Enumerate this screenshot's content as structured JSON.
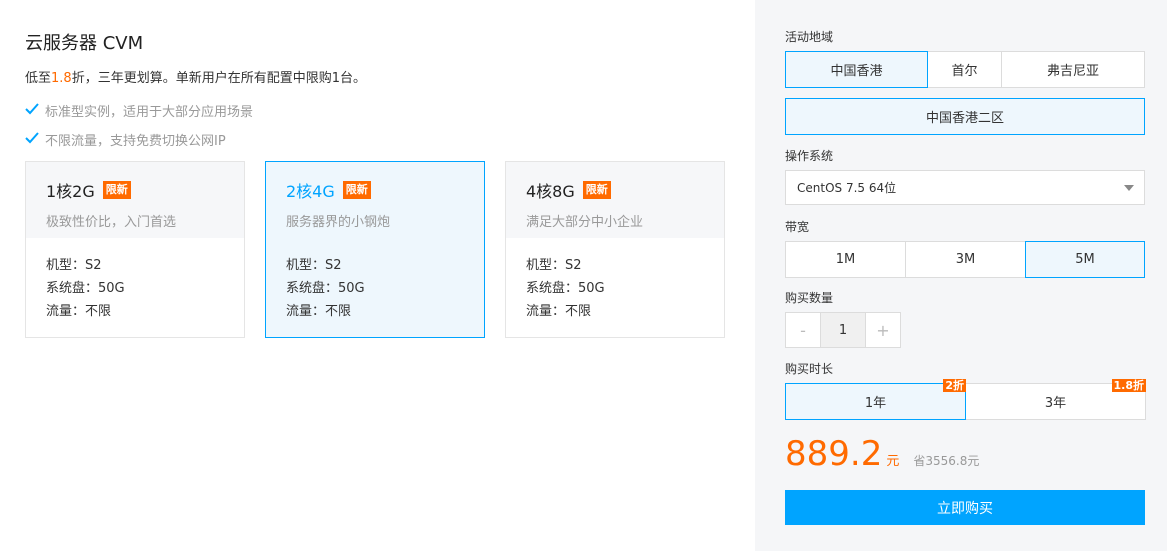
{
  "product": {
    "title": "云服务器 CVM",
    "desc_prefix": "低至",
    "desc_highlight": "1.8",
    "desc_suffix": "折，三年更划算。单新用户在所有配置中限购1台。",
    "features": [
      "标准型实例，适用于大部分应用场景",
      "不限流量，支持免费切换公网IP"
    ]
  },
  "cards": [
    {
      "name": "1核2G",
      "badge": "限新",
      "sub": "极致性价比，入门首选",
      "type": "机型：S2",
      "disk": "系统盘：50G",
      "traffic": "流量：不限",
      "selected": false
    },
    {
      "name": "2核4G",
      "badge": "限新",
      "sub": "服务器界的小钢炮",
      "type": "机型：S2",
      "disk": "系统盘：50G",
      "traffic": "流量：不限",
      "selected": true
    },
    {
      "name": "4核8G",
      "badge": "限新",
      "sub": "满足大部分中小企业",
      "type": "机型：S2",
      "disk": "系统盘：50G",
      "traffic": "流量：不限",
      "selected": false
    }
  ],
  "config": {
    "region_label": "活动地域",
    "regions": [
      "中国香港",
      "首尔",
      "弗吉尼亚"
    ],
    "zone": "中国香港二区",
    "os_label": "操作系统",
    "os_value": "CentOS 7.5 64位",
    "bandwidth_label": "带宽",
    "bandwidths": [
      "1M",
      "3M",
      "5M"
    ],
    "qty_label": "购买数量",
    "qty_minus": "-",
    "qty_value": "1",
    "qty_plus": "+",
    "duration_label": "购买时长",
    "durations": [
      {
        "label": "1年",
        "discount": "2折"
      },
      {
        "label": "3年",
        "discount": "1.8折"
      }
    ],
    "price": "889.2",
    "price_unit": "元",
    "save": "省3556.8元",
    "buy_label": "立即购买"
  },
  "colors": {
    "accent": "#00a4ff",
    "promo": "#ff6a00"
  }
}
